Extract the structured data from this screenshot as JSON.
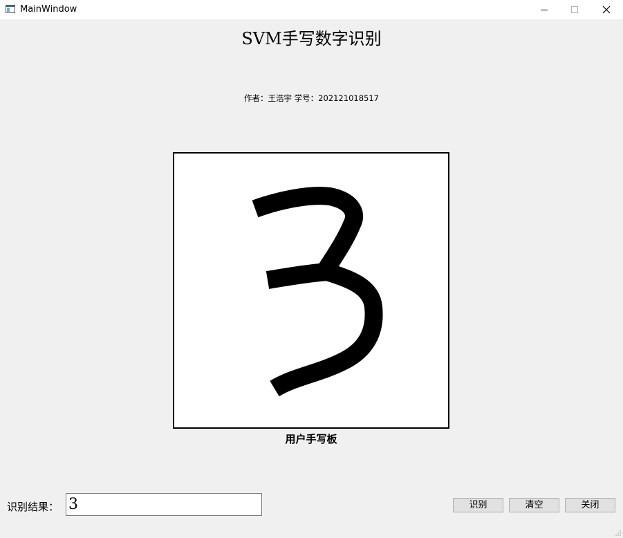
{
  "window": {
    "title": "MainWindow",
    "controls": [
      "minimize-icon",
      "maximize-icon",
      "close-icon"
    ]
  },
  "header": {
    "title": "SVM手写数字识别",
    "author_line": "作者：王浩宇  学号：202121018517"
  },
  "canvas": {
    "label": "用户手写板",
    "drawn_digit": "3",
    "stroke_color": "#000000",
    "background_color": "#ffffff"
  },
  "result": {
    "label": "识别结果：",
    "value": "3"
  },
  "buttons": {
    "recognize": "识别",
    "clear": "清空",
    "close": "关闭"
  }
}
